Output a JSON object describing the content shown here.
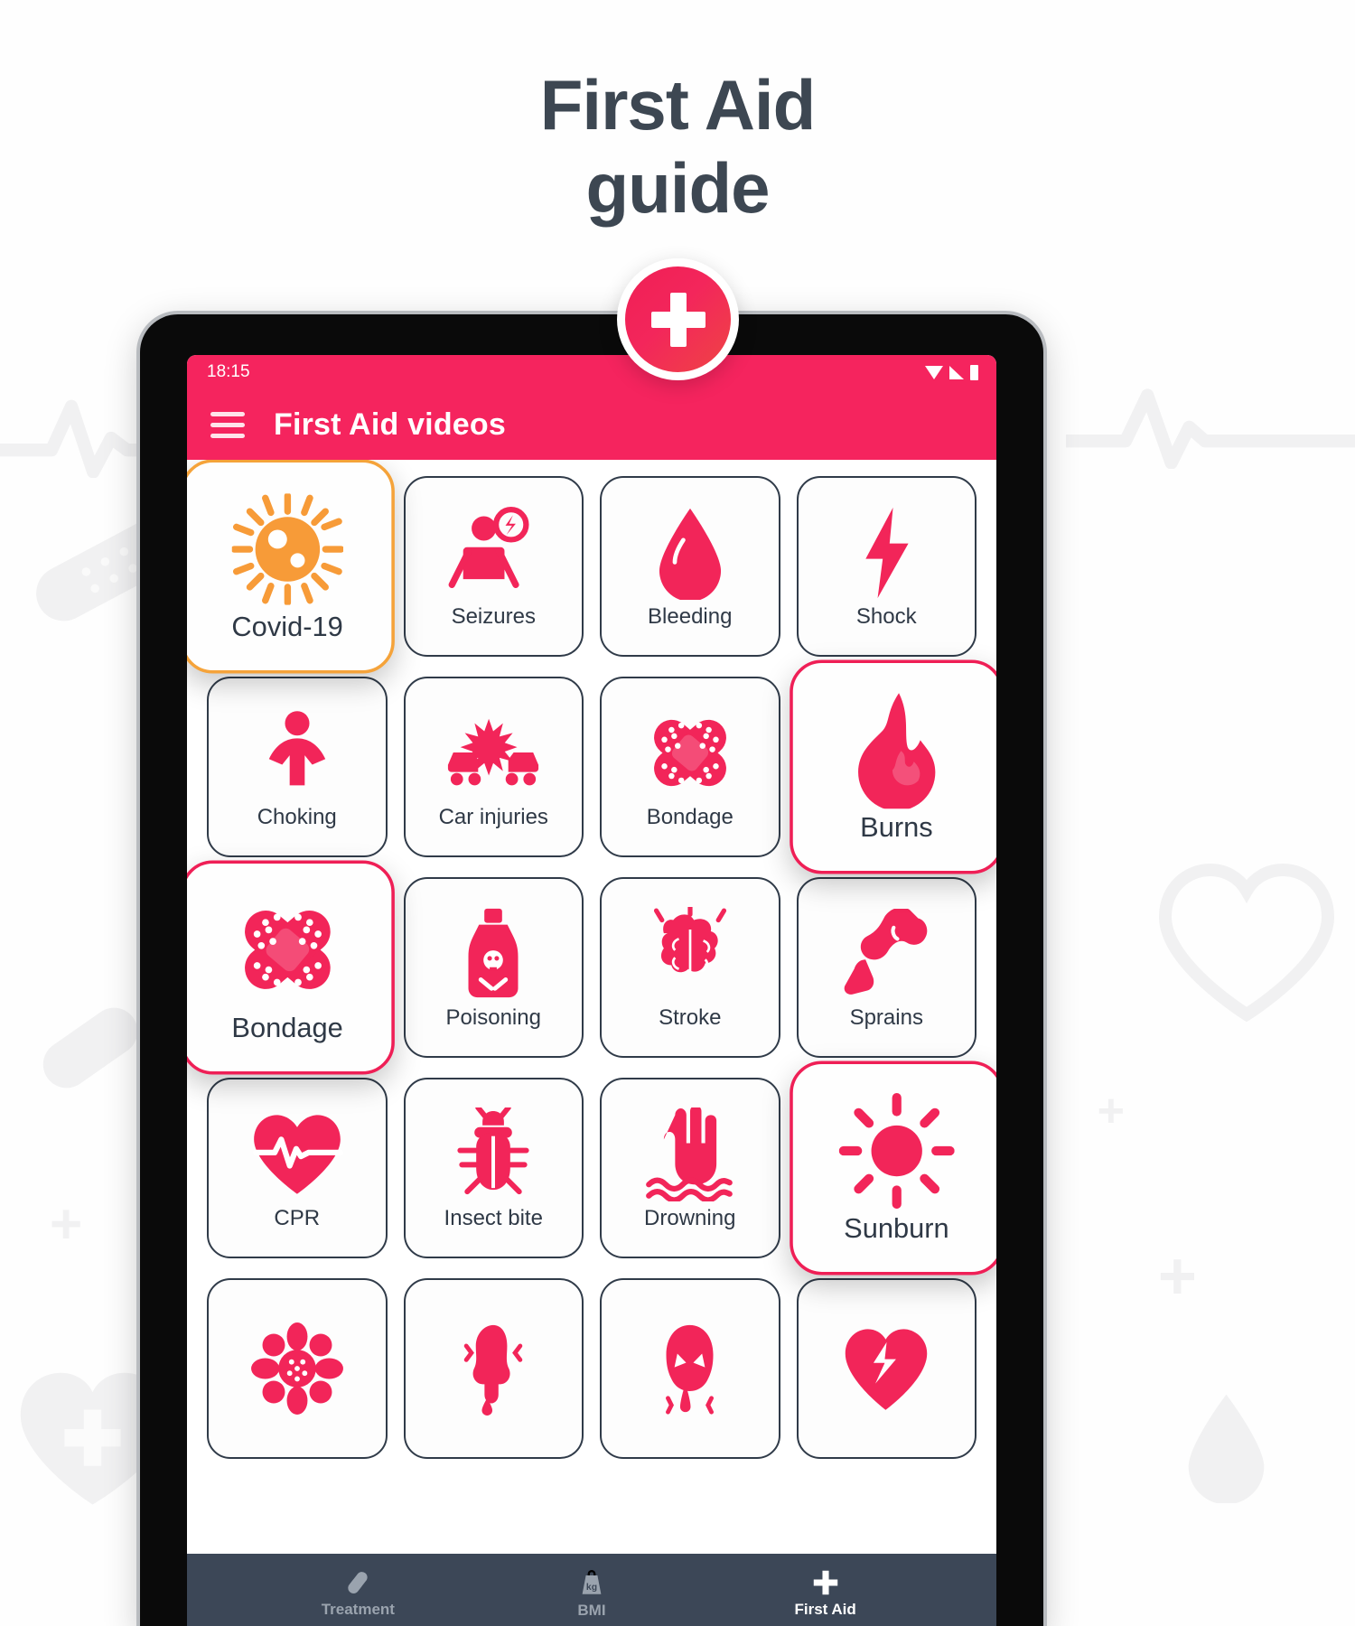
{
  "headline": {
    "line1": "First Aid",
    "line2": "guide"
  },
  "badge": {
    "icon": "medical-cross-icon"
  },
  "status_bar": {
    "time": "18:15",
    "icons": [
      "wifi-icon",
      "signal-icon",
      "battery-icon"
    ]
  },
  "app_bar": {
    "menu_icon": "hamburger-menu-icon",
    "title": "First Aid videos"
  },
  "colors": {
    "brand_pink": "#f5245e",
    "icon_pink": "#f22559",
    "highlight_border": "#ef1f56",
    "covid_orange": "#f79b38",
    "text_dark": "#2f3946",
    "nav_bg": "#3c4757",
    "headline": "#3d4752"
  },
  "grid": {
    "tiles": [
      {
        "label": "Covid-19",
        "icon": "virus-icon",
        "highlighted": true,
        "accent": "orange"
      },
      {
        "label": "Seizures",
        "icon": "seizure-icon",
        "highlighted": false,
        "accent": "pink"
      },
      {
        "label": "Bleeding",
        "icon": "blood-drop-icon",
        "highlighted": false,
        "accent": "pink"
      },
      {
        "label": "Shock",
        "icon": "lightning-bolt-icon",
        "highlighted": false,
        "accent": "pink"
      },
      {
        "label": "Choking",
        "icon": "choking-person-icon",
        "highlighted": false,
        "accent": "pink"
      },
      {
        "label": "Car injuries",
        "icon": "car-crash-icon",
        "highlighted": false,
        "accent": "pink"
      },
      {
        "label": "Bondage",
        "icon": "bandage-cross-icon",
        "highlighted": false,
        "accent": "pink"
      },
      {
        "label": "Burns",
        "icon": "flame-icon",
        "highlighted": true,
        "accent": "pink"
      },
      {
        "label": "Bondage",
        "icon": "bandage-cross-icon",
        "highlighted": true,
        "accent": "pink"
      },
      {
        "label": "Poisoning",
        "icon": "poison-bottle-icon",
        "highlighted": false,
        "accent": "pink"
      },
      {
        "label": "Stroke",
        "icon": "brain-icon",
        "highlighted": false,
        "accent": "pink"
      },
      {
        "label": "Sprains",
        "icon": "joint-sprain-icon",
        "highlighted": false,
        "accent": "pink"
      },
      {
        "label": "CPR",
        "icon": "heart-pulse-icon",
        "highlighted": false,
        "accent": "pink"
      },
      {
        "label": "Insect bite",
        "icon": "bug-icon",
        "highlighted": false,
        "accent": "pink"
      },
      {
        "label": "Drowning",
        "icon": "drowning-hand-icon",
        "highlighted": false,
        "accent": "pink"
      },
      {
        "label": "Sunburn",
        "icon": "sun-icon",
        "highlighted": true,
        "accent": "pink"
      },
      {
        "label": "",
        "icon": "flower-allergy-icon",
        "highlighted": false,
        "accent": "pink"
      },
      {
        "label": "",
        "icon": "nose-bleed-icon",
        "highlighted": false,
        "accent": "pink"
      },
      {
        "label": "",
        "icon": "vomiting-icon",
        "highlighted": false,
        "accent": "pink"
      },
      {
        "label": "",
        "icon": "heart-attack-icon",
        "highlighted": false,
        "accent": "pink"
      }
    ]
  },
  "bottom_nav": {
    "items": [
      {
        "label": "Treatment",
        "icon": "pill-icon",
        "active": false
      },
      {
        "label": "BMI",
        "icon": "kg-weight-icon",
        "active": false
      },
      {
        "label": "First Aid",
        "icon": "medical-cross-icon",
        "active": true
      }
    ]
  }
}
